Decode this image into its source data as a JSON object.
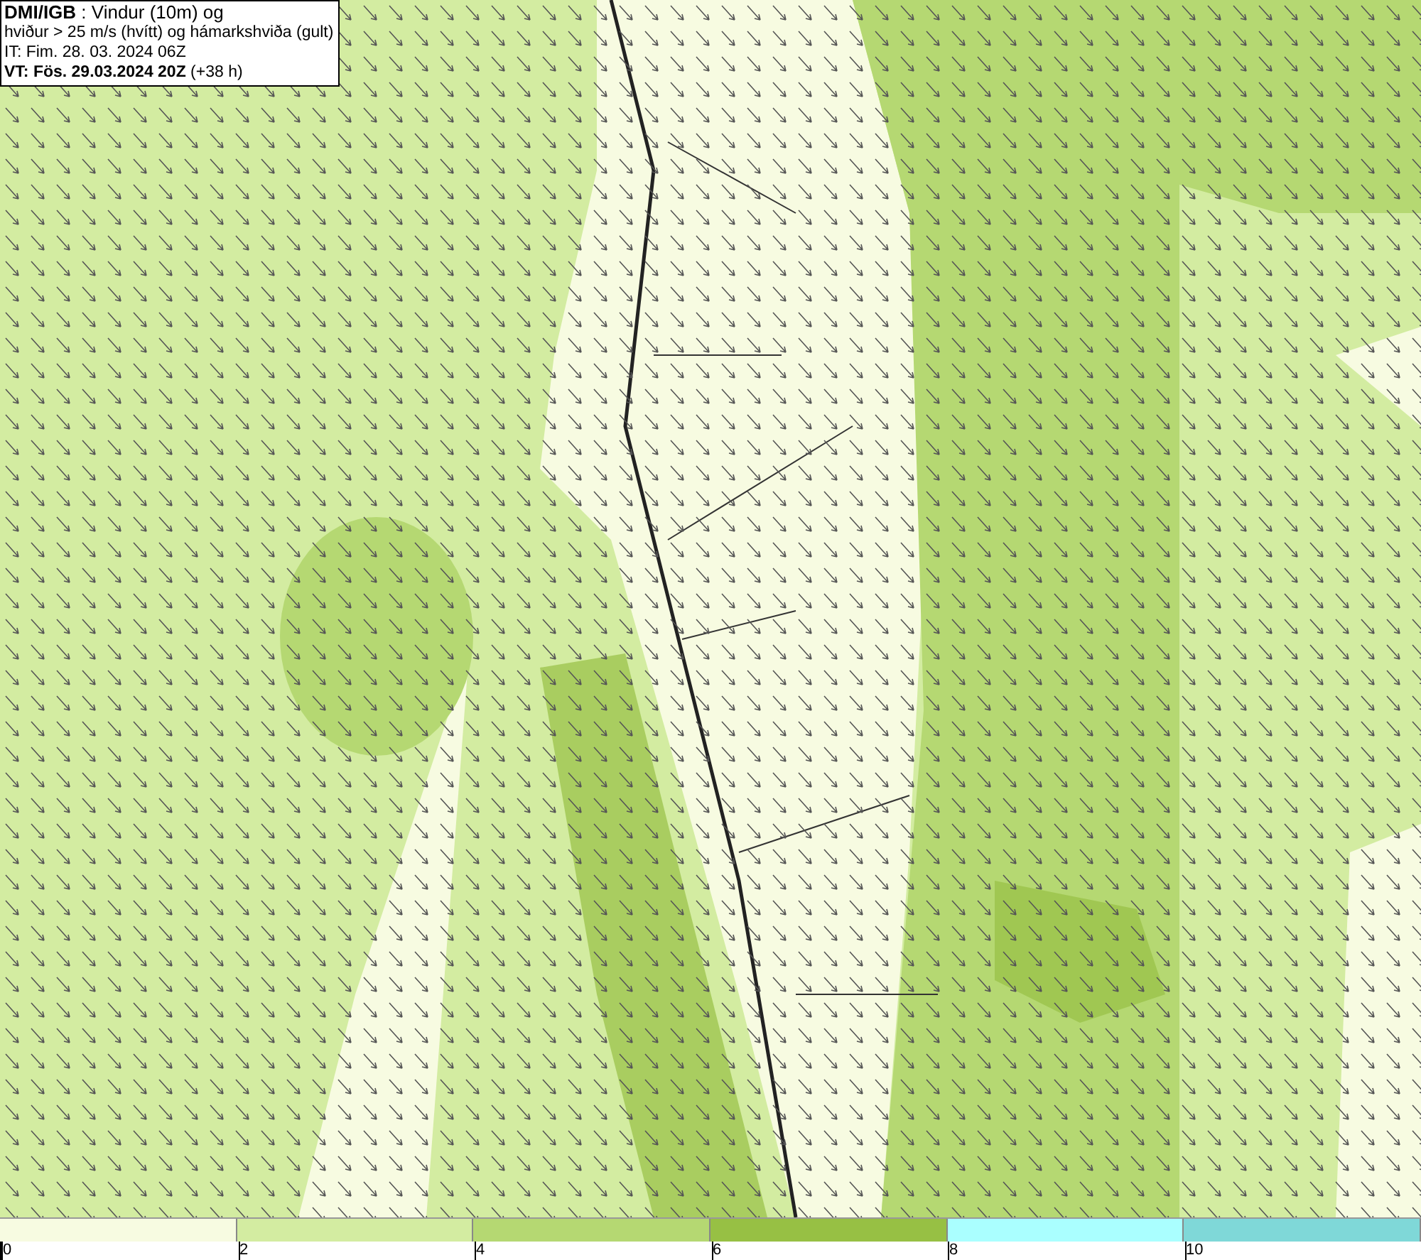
{
  "header": {
    "lines": [
      "**DMI/IGB** : Vindur (10m) og",
      "hviður > 25 m/s (hvítt) og hámarkshviða (gult)",
      "IT: Fim. 28. 03. 2024 06Z",
      "**VT: Fös. 29.03.2024 20Z** (+38 h)"
    ]
  },
  "legend": {
    "bins": [
      {
        "label": "0",
        "color": "#f7fbe1"
      },
      {
        "label": "2",
        "color": "#d3eca1"
      },
      {
        "label": "4",
        "color": "#b5d872"
      },
      {
        "label": "6",
        "color": "#97c044"
      },
      {
        "label": "8",
        "color": "#aaffff"
      },
      {
        "label": "10",
        "color": "#7fd8d8"
      }
    ]
  }
}
